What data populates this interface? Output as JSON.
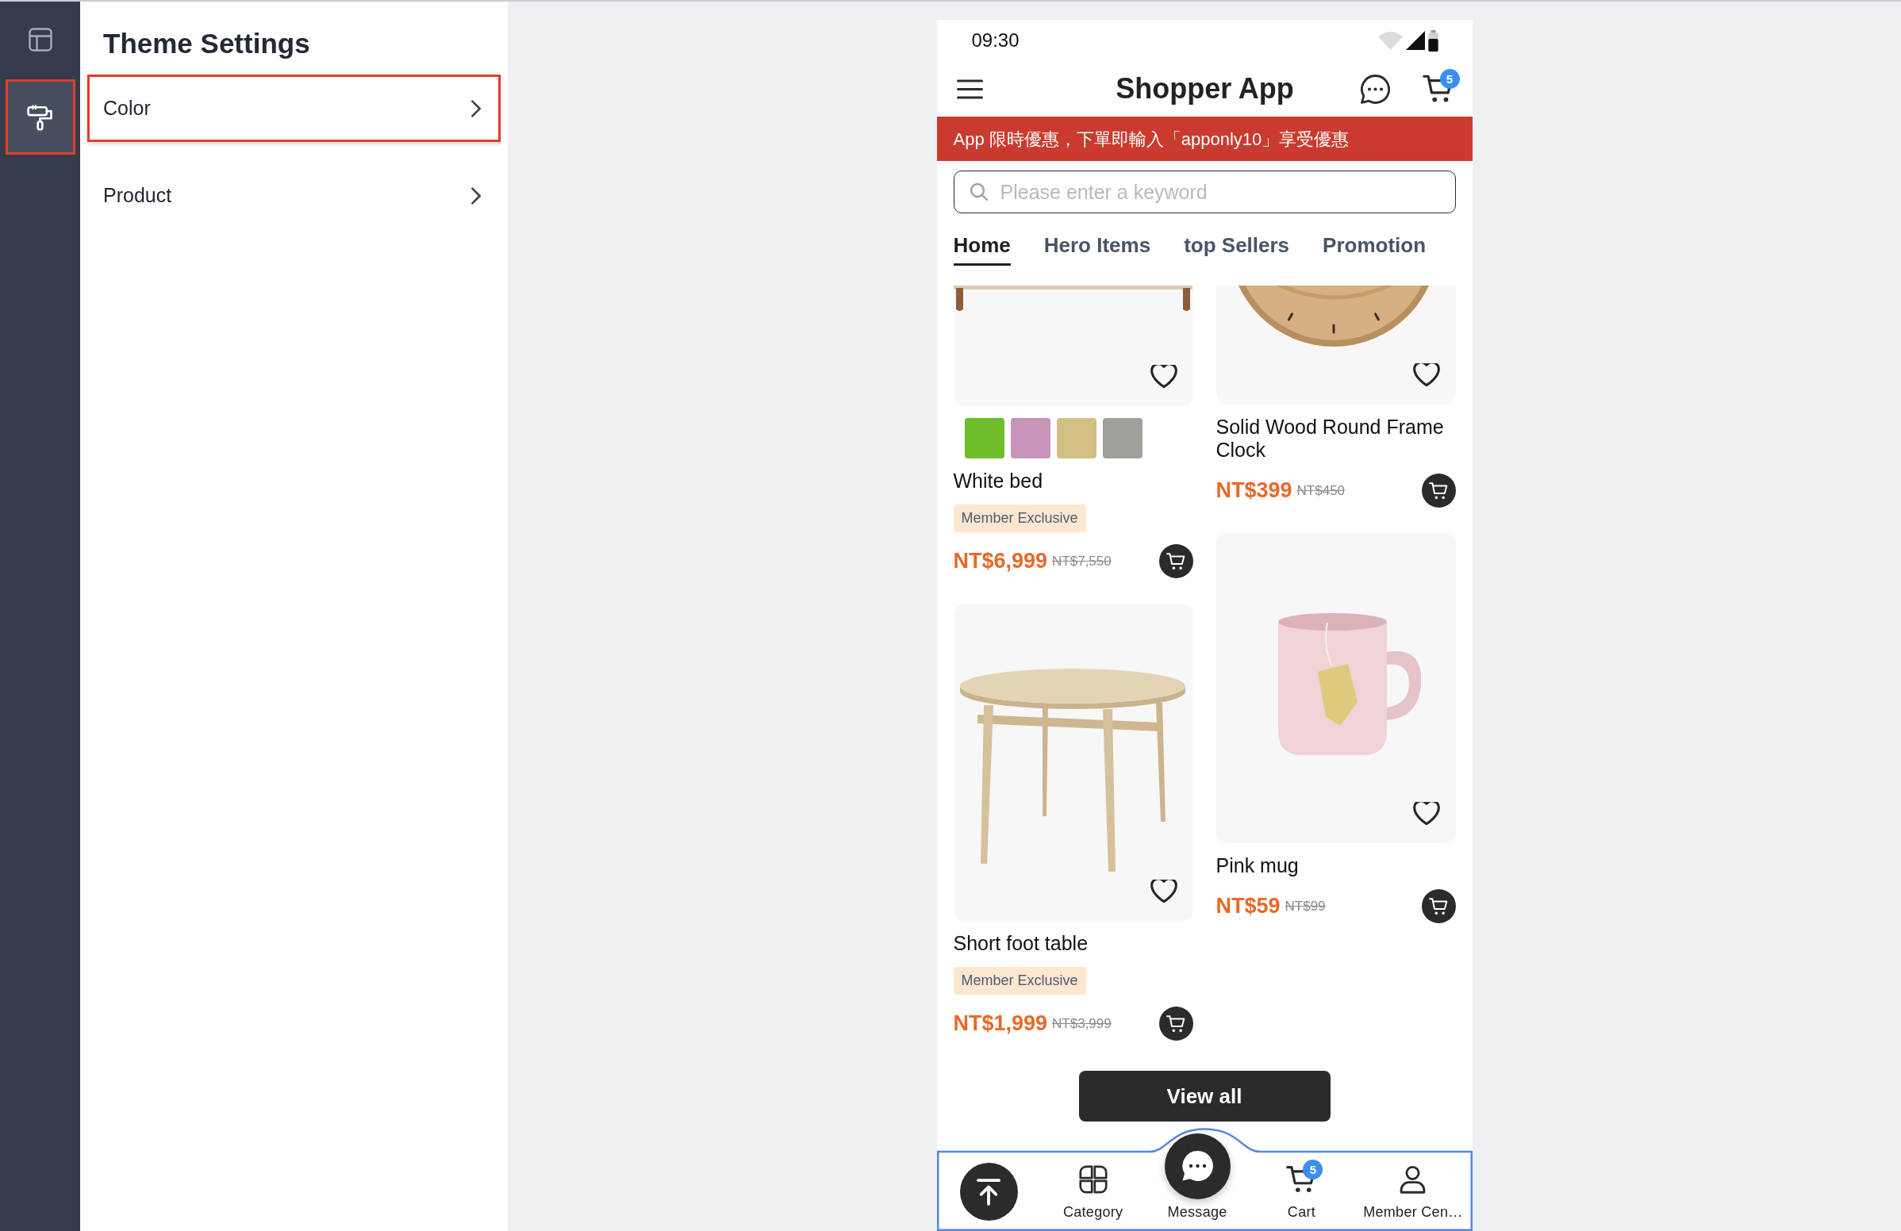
{
  "rail": {
    "items": [
      {
        "kind": "layout",
        "selected": false,
        "highlighted": false
      },
      {
        "kind": "theme",
        "selected": true,
        "highlighted": true
      }
    ]
  },
  "settings": {
    "title": "Theme Settings",
    "items": [
      {
        "label": "Color",
        "highlighted": true
      },
      {
        "label": "Product",
        "highlighted": false
      }
    ]
  },
  "phone": {
    "status_bar": {
      "time": "09:30"
    },
    "header": {
      "title": "Shopper App",
      "cart_badge": "5"
    },
    "banner": {
      "text": "App 限時優惠，下單即輸入「apponly10」享受優惠"
    },
    "search": {
      "placeholder": "Please enter a keyword"
    },
    "tabs": [
      {
        "label": "Home",
        "selected": true
      },
      {
        "label": "Hero Items",
        "selected": false
      },
      {
        "label": "top Sellers",
        "selected": false
      },
      {
        "label": "Promotion",
        "selected": false
      }
    ],
    "product_columns": [
      {
        "products": [
          {
            "kind": "bed",
            "swatches": [
              {
                "color": "#6ebd2b"
              },
              {
                "color": "#c894ba"
              },
              {
                "color": "#d4bf83"
              },
              {
                "color": "#a0a09b"
              }
            ],
            "name": "White bed",
            "tag": "Member Exclusive",
            "price": "NT$6,999",
            "original_price": "NT$7,550"
          },
          {
            "kind": "table",
            "name": "Short foot table",
            "tag": "Member Exclusive",
            "price": "NT$1,999",
            "original_price": "NT$3,999"
          }
        ]
      },
      {
        "products": [
          {
            "kind": "clock",
            "name": "Solid Wood Round Frame Clock",
            "price": "NT$399",
            "original_price": "NT$450"
          },
          {
            "kind": "mug",
            "name": "Pink mug",
            "price": "NT$59",
            "original_price": "NT$99"
          }
        ]
      }
    ],
    "view_all": {
      "label": "View all"
    },
    "bottom_nav": {
      "items": [
        {
          "kind": "top"
        },
        {
          "kind": "category",
          "label": "Category"
        },
        {
          "kind": "message",
          "label": "Message"
        },
        {
          "kind": "cart",
          "label": "Cart",
          "badge": "5"
        },
        {
          "kind": "member",
          "label": "Member Cen…"
        }
      ]
    }
  }
}
